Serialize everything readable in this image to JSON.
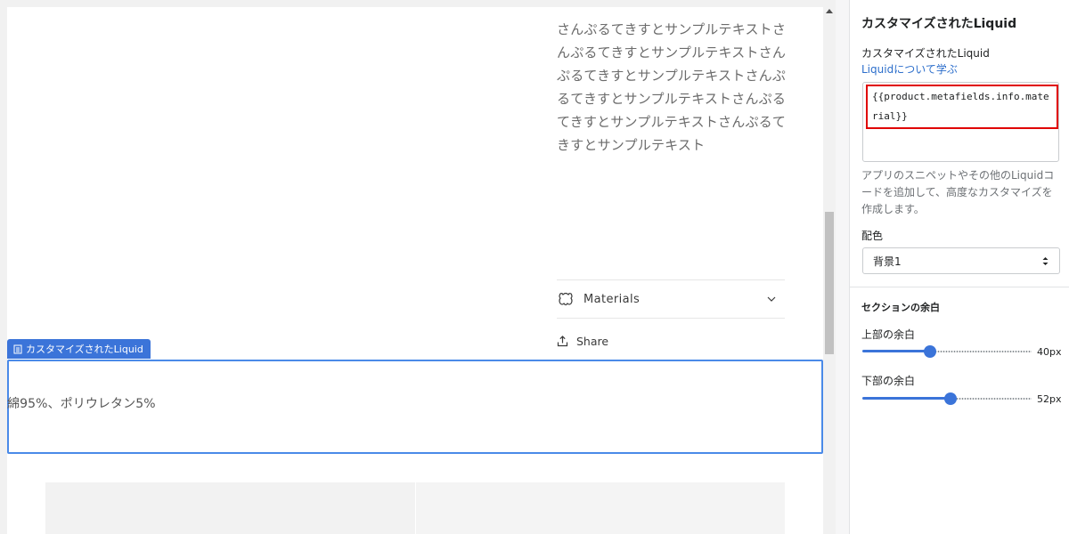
{
  "preview": {
    "description": "さんぷるてきすとサンプルテキストさんぷるてきすとサンプルテキストさんぷるてきすとサンプルテキストさんぷるてきすとサンプルテキストさんぷるてきすとサンプルテキストさんぷるてきすとサンプルテキスト",
    "materials_label": "Materials",
    "share_label": "Share",
    "selected_section_tag": "カスタマイズされたLiquid",
    "section_output": "綿95%、ポリウレタン5%"
  },
  "panel": {
    "title": "カスタマイズされたLiquid",
    "field_label": "カスタマイズされたLiquid",
    "learn_link": "Liquidについて学ぶ",
    "code_value": "{{product.metafields.info.material}}",
    "help_text": "アプリのスニペットやその他のLiquidコードを追加して、高度なカスタマイズを作成します。",
    "color_scheme_label": "配色",
    "color_scheme_value": "背景1",
    "spacing_heading": "セクションの余白",
    "top_padding": {
      "label": "上部の余白",
      "value": 40,
      "unit": "px",
      "display": "40px",
      "min": 0,
      "max": 100
    },
    "bottom_padding": {
      "label": "下部の余白",
      "value": 52,
      "unit": "px",
      "display": "52px",
      "min": 0,
      "max": 100
    }
  },
  "colors": {
    "accent": "#3b74d9",
    "selection_border": "#4a8ae8",
    "highlight_red": "#e00000",
    "link": "#2c6ecb"
  },
  "icons": {
    "materials": "fabric-icon",
    "materials_expand": "chevron-down-icon",
    "share": "share-icon",
    "section_tag": "section-icon",
    "select": "select-arrows-icon"
  }
}
